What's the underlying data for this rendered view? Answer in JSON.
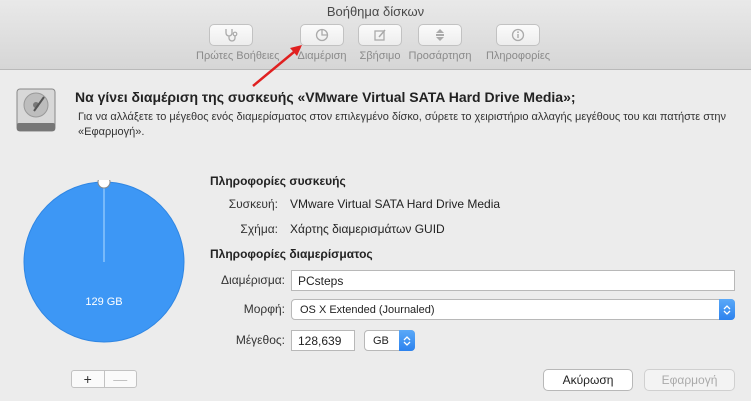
{
  "window": {
    "title": "Βοήθημα δίσκων"
  },
  "toolbar": {
    "items": [
      {
        "label": "Πρώτες Βοήθειες",
        "icon": "stethoscope-icon"
      },
      {
        "label": "Διαμέριση",
        "icon": "partition-icon"
      },
      {
        "label": "Σβήσιμο",
        "icon": "erase-icon"
      },
      {
        "label": "Προσάρτηση",
        "icon": "mount-icon"
      },
      {
        "label": "Πληροφορίες",
        "icon": "info-icon"
      }
    ]
  },
  "header": {
    "heading": "Να γίνει διαμέριση της συσκευής «VMware Virtual SATA Hard Drive Media»;",
    "description": "Για να αλλάξετε το μέγεθος ενός διαμερίσματος στον επιλεγμένο δίσκο, σύρετε το χειριστήριο αλλαγής μεγέθους του και πατήστε στην «Εφαρμογή»."
  },
  "pie": {
    "label": "129 GB",
    "color": "#3d97f5"
  },
  "device_info": {
    "title": "Πληροφορίες συσκευής",
    "device_label": "Συσκευή:",
    "device_value": "VMware Virtual SATA Hard Drive Media",
    "scheme_label": "Σχήμα:",
    "scheme_value": "Χάρτης διαμερισμάτων GUID"
  },
  "partition_info": {
    "title": "Πληροφορίες διαμερίσματος",
    "partition_label": "Διαμέρισμα:",
    "partition_value": "PCsteps",
    "format_label": "Μορφή:",
    "format_value": "OS X Extended (Journaled)",
    "size_label": "Μέγεθος:",
    "size_value": "128,639",
    "size_unit": "GB"
  },
  "footer": {
    "add": "+",
    "remove": "—",
    "cancel": "Ακύρωση",
    "apply": "Εφαρμογή"
  },
  "colors": {
    "accent": "#2c82ee",
    "annotation_arrow": "#e02020"
  }
}
